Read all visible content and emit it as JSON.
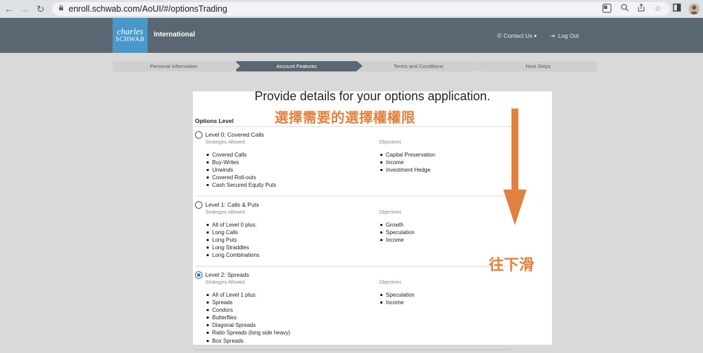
{
  "browser": {
    "url": "enroll.schwab.com/AoUI/#/optionsTrading"
  },
  "header": {
    "logo_line1": "charles",
    "logo_line2": "SCHWAB",
    "region": "International",
    "contact_label": "Contact Us",
    "logout_label": "Log Out"
  },
  "steps": [
    {
      "label": "Personal Information",
      "active": false
    },
    {
      "label": "Account Features",
      "active": true
    },
    {
      "label": "Terms and Conditions",
      "active": false
    },
    {
      "label": "Next Steps",
      "active": false
    }
  ],
  "main": {
    "title": "Provide details for your options application.",
    "section_label": "Options Level",
    "levels": [
      {
        "title": "Level 0: Covered Calls",
        "selected": false,
        "strategies_heading": "Strategies Allowed",
        "objectives_heading": "Objectives",
        "strategies": [
          "Covered Calls",
          "Buy-Writes",
          "Unwinds",
          "Covered Roll-outs",
          "Cash Secured Equity Puts"
        ],
        "objectives": [
          "Capital Preservation",
          "Income",
          "Investment Hedge"
        ]
      },
      {
        "title": "Level 1: Calls & Puts",
        "selected": false,
        "strategies_heading": "Strategies Allowed",
        "objectives_heading": "Objectives",
        "strategies": [
          "All of Level 0 plus:",
          "Long Calls",
          "Long Puts",
          "Long Straddles",
          "Long Combinations"
        ],
        "objectives": [
          "Growth",
          "Speculation",
          "Income"
        ]
      },
      {
        "title": "Level 2: Spreads",
        "selected": true,
        "strategies_heading": "Strategies Allowed",
        "objectives_heading": "Objectives",
        "strategies": [
          "All of Level 1 plus:",
          "Spreads",
          "Condors",
          "Butterflies",
          "Diagonal Spreads",
          "Ratio Spreads (long side heavy)",
          "Box Spreads"
        ],
        "objectives": [
          "Speculation",
          "Income"
        ]
      }
    ]
  },
  "annotations": {
    "select_text": "選擇需要的選擇權權限",
    "scroll_text": "往下滑",
    "color": "#e1813d"
  },
  "colors": {
    "header_bg": "#5a6772",
    "logo_bg": "#4a98c9",
    "radio_selected": "#2d6fb7"
  }
}
